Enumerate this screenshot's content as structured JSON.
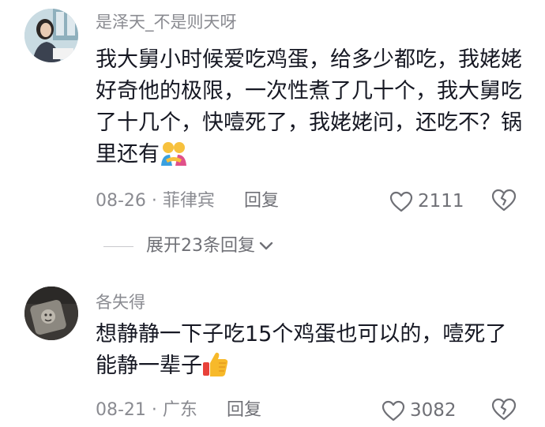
{
  "comments": [
    {
      "username": "是泽天_不是则天呀",
      "text": "我大舅小时候爱吃鸡蛋，给多少都吃，我姥姥好奇他的极限，一次性煮了几十个，我大舅吃了十几个，快噎死了，我姥姥问，还吃不？锅里还有",
      "emoji": "hugging-people-emoji",
      "date": "08-26",
      "location": "菲律宾",
      "reply_label": "回复",
      "likes": "2111",
      "replies_expand": "展开23条回复"
    },
    {
      "username": "各失得",
      "text": "想静静一下子吃15个鸡蛋也可以的，噎死了能静一辈子",
      "emoji": "thumbs-up-emoji",
      "date": "08-21",
      "location": "广东",
      "reply_label": "回复",
      "likes": "3082"
    }
  ],
  "separator": " · ",
  "colors": {
    "text": "#161823",
    "secondary": "#8a8b91",
    "icon": "#6f7076"
  }
}
